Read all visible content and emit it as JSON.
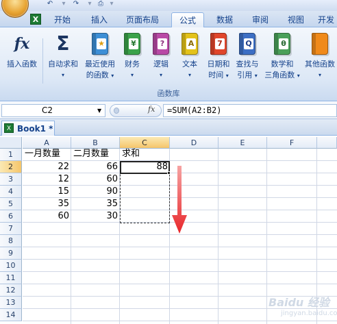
{
  "ribbon": {
    "tabs": [
      "开始",
      "插入",
      "页面布局",
      "公式",
      "数据",
      "审阅",
      "视图",
      "开发"
    ],
    "active_tab": "公式",
    "buttons": [
      {
        "line1": "插入函数",
        "line2": ""
      },
      {
        "line1": "自动求和",
        "line2": ""
      },
      {
        "line1": "最近使用",
        "line2": "的函数"
      },
      {
        "line1": "财务",
        "line2": ""
      },
      {
        "line1": "逻辑",
        "line2": ""
      },
      {
        "line1": "文本",
        "line2": ""
      },
      {
        "line1": "日期和",
        "line2": "时间"
      },
      {
        "line1": "查找与",
        "line2": "引用"
      },
      {
        "line1": "数学和",
        "line2": "三角函数"
      },
      {
        "line1": "其他函数",
        "line2": ""
      }
    ],
    "group_label": "函数库",
    "icon_glyphs": {
      "fx": "fx",
      "sigma": "Σ",
      "star": "★",
      "finance": "¥",
      "logic": "?",
      "text": "A",
      "date": "7",
      "lookup": "Q",
      "math": "θ"
    },
    "icon_colors": {
      "recent": "#3d8fd6",
      "finance": "#3aa24a",
      "logic": "#b94aa6",
      "text": "#e3c21a",
      "date": "#e0462b",
      "lookup": "#3d6fc4",
      "math": "#4aa05a",
      "other": "#f08a1a"
    }
  },
  "formula_bar": {
    "name_box": "C2",
    "fx_label": "fx",
    "formula": "=SUM(A2:B2)"
  },
  "workbook": {
    "tab_title": "Book1 *"
  },
  "sheet": {
    "columns": [
      "A",
      "B",
      "C",
      "D",
      "E",
      "F"
    ],
    "rows": [
      "1",
      "2",
      "3",
      "4",
      "5",
      "6",
      "7",
      "8",
      "9",
      "10",
      "11",
      "12",
      "13",
      "14"
    ],
    "header_row": [
      "一月数量",
      "二月数量",
      "求和"
    ],
    "data": [
      [
        "22",
        "66",
        "88"
      ],
      [
        "12",
        "60",
        ""
      ],
      [
        "15",
        "90",
        ""
      ],
      [
        "35",
        "35",
        ""
      ],
      [
        "60",
        "30",
        ""
      ]
    ],
    "active_cell": "C2"
  },
  "watermark_text": "Baidu 经验",
  "watermark_url": "jingyan.baidu.com"
}
